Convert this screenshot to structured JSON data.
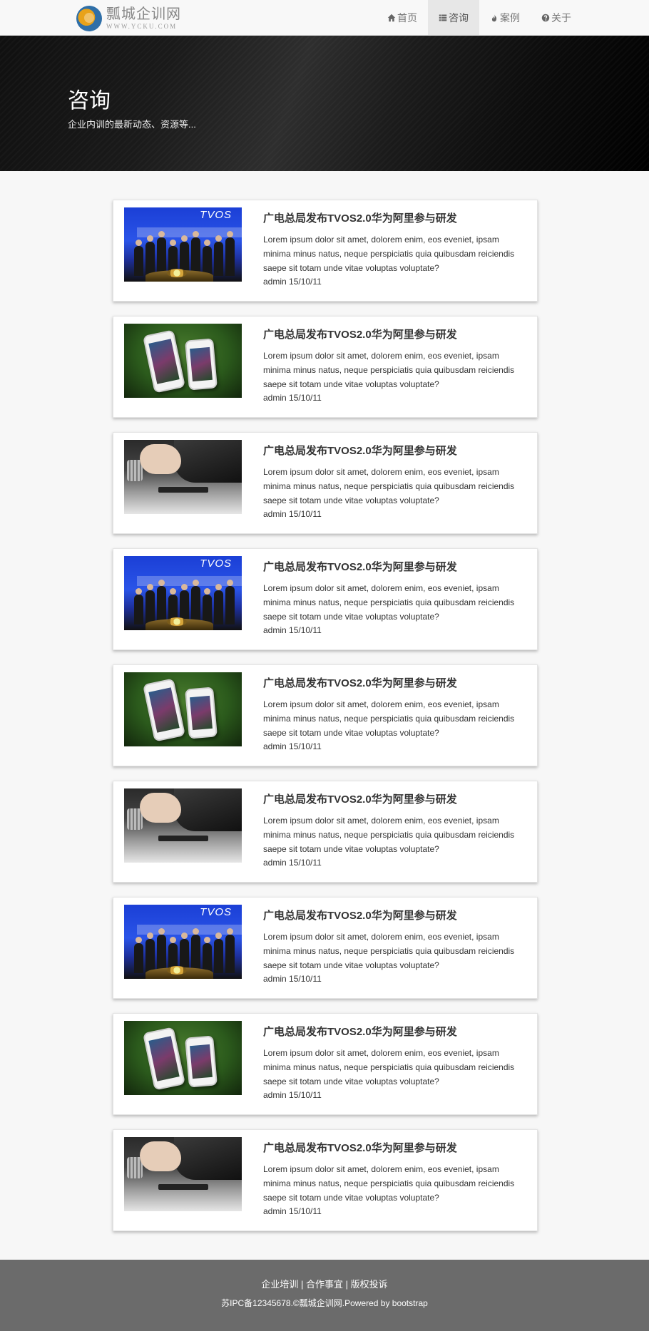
{
  "navbar": {
    "logo_cn": "瓢城企训网",
    "logo_en": "WWW.YCKU.COM",
    "items": [
      {
        "label": "首页",
        "icon": "home-icon"
      },
      {
        "label": "咨询",
        "icon": "list-icon",
        "active": true
      },
      {
        "label": "案例",
        "icon": "fire-icon"
      },
      {
        "label": "关于",
        "icon": "question-circle-icon"
      }
    ]
  },
  "hero": {
    "title": "咨询",
    "subtitle": "企业内训的最新动态、资源等..."
  },
  "articles": [
    {
      "title": "广电总局发布TVOS2.0华为阿里参与研发",
      "excerpt": "Lorem ipsum dolor sit amet, dolorem enim, eos eveniet, ipsam minima minus natus, neque perspiciatis quia quibusdam reiciendis saepe sit totam unde vitae voluptas voluptate?",
      "meta": "admin 15/10/11",
      "image": "event"
    },
    {
      "title": "广电总局发布TVOS2.0华为阿里参与研发",
      "excerpt": "Lorem ipsum dolor sit amet, dolorem enim, eos eveniet, ipsam minima minus natus, neque perspiciatis quia quibusdam reiciendis saepe sit totam unde vitae voluptas voluptate?",
      "meta": "admin 15/10/11",
      "image": "phones"
    },
    {
      "title": "广电总局发布TVOS2.0华为阿里参与研发",
      "excerpt": "Lorem ipsum dolor sit amet, dolorem enim, eos eveniet, ipsam minima minus natus, neque perspiciatis quia quibusdam reiciendis saepe sit totam unde vitae voluptas voluptate?",
      "meta": "admin 15/10/11",
      "image": "hand"
    },
    {
      "title": "广电总局发布TVOS2.0华为阿里参与研发",
      "excerpt": "Lorem ipsum dolor sit amet, dolorem enim, eos eveniet, ipsam minima minus natus, neque perspiciatis quia quibusdam reiciendis saepe sit totam unde vitae voluptas voluptate?",
      "meta": "admin 15/10/11",
      "image": "event"
    },
    {
      "title": "广电总局发布TVOS2.0华为阿里参与研发",
      "excerpt": "Lorem ipsum dolor sit amet, dolorem enim, eos eveniet, ipsam minima minus natus, neque perspiciatis quia quibusdam reiciendis saepe sit totam unde vitae voluptas voluptate?",
      "meta": "admin 15/10/11",
      "image": "phones"
    },
    {
      "title": "广电总局发布TVOS2.0华为阿里参与研发",
      "excerpt": "Lorem ipsum dolor sit amet, dolorem enim, eos eveniet, ipsam minima minus natus, neque perspiciatis quia quibusdam reiciendis saepe sit totam unde vitae voluptas voluptate?",
      "meta": "admin 15/10/11",
      "image": "hand"
    },
    {
      "title": "广电总局发布TVOS2.0华为阿里参与研发",
      "excerpt": "Lorem ipsum dolor sit amet, dolorem enim, eos eveniet, ipsam minima minus natus, neque perspiciatis quia quibusdam reiciendis saepe sit totam unde vitae voluptas voluptate?",
      "meta": "admin 15/10/11",
      "image": "event"
    },
    {
      "title": "广电总局发布TVOS2.0华为阿里参与研发",
      "excerpt": "Lorem ipsum dolor sit amet, dolorem enim, eos eveniet, ipsam minima minus natus, neque perspiciatis quia quibusdam reiciendis saepe sit totam unde vitae voluptas voluptate?",
      "meta": "admin 15/10/11",
      "image": "phones"
    },
    {
      "title": "广电总局发布TVOS2.0华为阿里参与研发",
      "excerpt": "Lorem ipsum dolor sit amet, dolorem enim, eos eveniet, ipsam minima minus natus, neque perspiciatis quia quibusdam reiciendis saepe sit totam unde vitae voluptas voluptate?",
      "meta": "admin 15/10/11",
      "image": "hand"
    }
  ],
  "footer": {
    "links": [
      "企业培训",
      "合作事宜",
      "版权投诉"
    ],
    "separator": "|",
    "copyright": "苏IPC备12345678.©瓢城企训网.Powered by bootstrap"
  }
}
